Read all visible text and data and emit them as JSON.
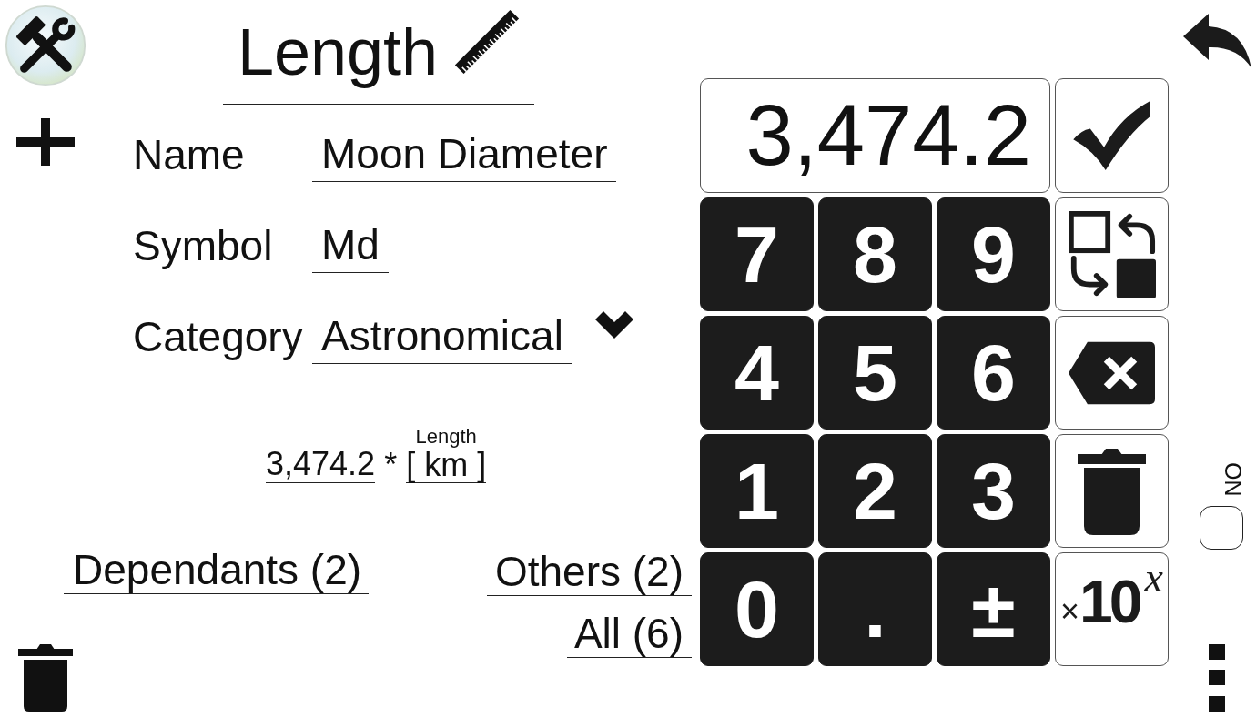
{
  "header": {
    "title": "Length"
  },
  "form": {
    "fields": [
      {
        "label": "Name",
        "value": "Moon Diameter",
        "kind": "text"
      },
      {
        "label": "Symbol",
        "value": "Md",
        "kind": "text"
      },
      {
        "label": "Category",
        "value": "Astronomical",
        "kind": "select"
      }
    ]
  },
  "formula": {
    "factor": "3,474.2",
    "operator": "*",
    "unit_quantity": "Length",
    "unit": "[ km ]"
  },
  "links": {
    "dependants": "Dependants (2)",
    "others": "Others (2)",
    "all": "All (6)"
  },
  "keypad": {
    "display": "3,474.2",
    "keys": [
      {
        "kind": "confirm"
      },
      {
        "kind": "digit",
        "label": "7"
      },
      {
        "kind": "digit",
        "label": "8"
      },
      {
        "kind": "digit",
        "label": "9"
      },
      {
        "kind": "swap"
      },
      {
        "kind": "digit",
        "label": "4"
      },
      {
        "kind": "digit",
        "label": "5"
      },
      {
        "kind": "digit",
        "label": "6"
      },
      {
        "kind": "backspace"
      },
      {
        "kind": "digit",
        "label": "1"
      },
      {
        "kind": "digit",
        "label": "2"
      },
      {
        "kind": "digit",
        "label": "3"
      },
      {
        "kind": "clear"
      },
      {
        "kind": "digit",
        "label": "0"
      },
      {
        "kind": "digit",
        "label": "."
      },
      {
        "kind": "digit",
        "label": "±"
      },
      {
        "kind": "exponent",
        "prefix": "×",
        "base": "10",
        "power": "x"
      }
    ]
  },
  "toggle": {
    "label": "NO",
    "checked": false
  }
}
